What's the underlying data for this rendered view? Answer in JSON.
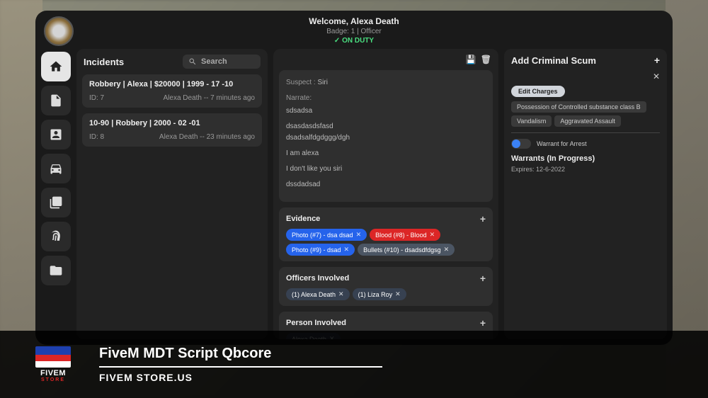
{
  "header": {
    "welcome": "Welcome, Alexa Death",
    "badge_line": "Badge: 1 | Officer",
    "duty_status": "ON DUTY"
  },
  "incidents_panel": {
    "title": "Incidents",
    "search_placeholder": "Search",
    "items": [
      {
        "title": "Robbery | Alexa | $20000 | 1999 - 17 -10",
        "id_label": "ID: 7",
        "meta": "Alexa Death -- 7 minutes ago"
      },
      {
        "title": "10-90 | Robbery | 2000 - 02 -01",
        "id_label": "ID: 8",
        "meta": "Alexa Death -- 23 minutes ago"
      }
    ]
  },
  "detail": {
    "suspect_label": "Suspect :",
    "suspect_value": "Siri",
    "narrate_label": "Narrate:",
    "lines": [
      "sdsadsa",
      "dsasdasdsfasd",
      "dsadsalfdgdggg/dgh",
      "I am alexa",
      "I don't like you siri",
      "dssdadsad"
    ],
    "evidence": {
      "title": "Evidence",
      "items": [
        {
          "label": "Photo (#7) - dsa dsad",
          "color": "blue"
        },
        {
          "label": "Blood (#8) - Blood",
          "color": "red"
        },
        {
          "label": "Photo (#9) - dsad",
          "color": "blue"
        },
        {
          "label": "Bullets (#10) - dsadsdfdgsg",
          "color": "gray"
        }
      ]
    },
    "officers": {
      "title": "Officers Involved",
      "items": [
        {
          "label": "(1) Alexa Death"
        },
        {
          "label": "(1) Liza Roy"
        }
      ]
    },
    "persons": {
      "title": "Person Involved",
      "items": [
        {
          "label": "Alexa Death"
        }
      ]
    }
  },
  "scum": {
    "title": "Add Criminal Scum",
    "edit_btn": "Edit Charges",
    "charges": [
      "Possession of Controlled substance class B",
      "Vandalism",
      "Aggravated Assault"
    ],
    "warrant_toggle_label": "Warrant for Arrest",
    "warrants_title": "Warrants (In Progress)",
    "warrants_exp": "Expires: 12-6-2022"
  },
  "promo": {
    "logo_text": "FIVEM",
    "logo_sub": "STORE",
    "title": "FiveM MDT Script Qbcore",
    "subtitle": "FIVEM STORE.US"
  }
}
